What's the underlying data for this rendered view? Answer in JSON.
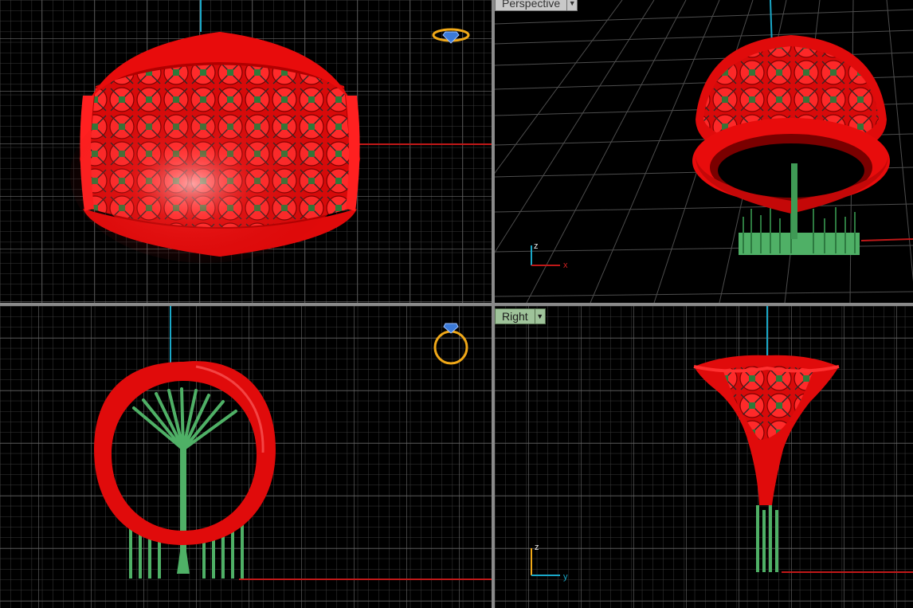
{
  "viewports": {
    "perspective": {
      "label": "Perspective"
    },
    "right": {
      "label": "Right"
    }
  },
  "axes": {
    "perspective": {
      "z": "z",
      "x": "x"
    },
    "right": {
      "z": "z",
      "y": "y"
    }
  },
  "colors": {
    "model": "#e00b0b",
    "model_dark": "#8e0000",
    "supports": "#4fb066",
    "grid_minor": "#3a3a3a",
    "grid_major": "#6a6a6a",
    "axis_x": "#c01818",
    "axis_y": "#1aa8c8",
    "gizmo": "#f0a818",
    "tab_active": "#9fc39a"
  },
  "icons": {
    "gizmo": "ring-gizmo-icon",
    "dropdown": "chevron-down-icon"
  }
}
